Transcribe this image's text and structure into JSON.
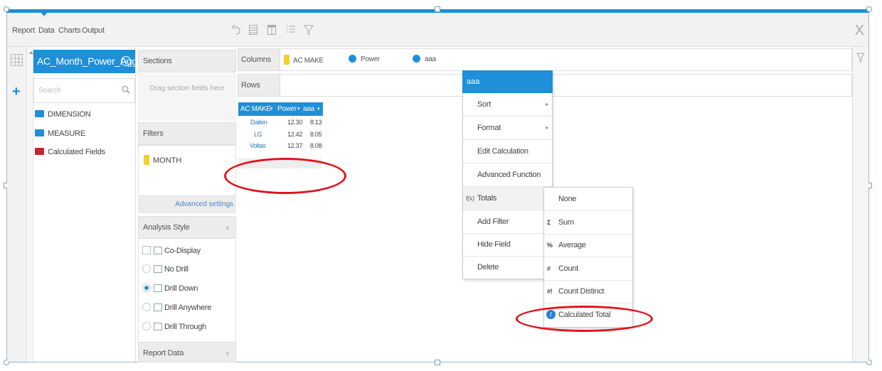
{
  "toolbar": {
    "tabs": [
      "Report",
      "Data",
      "Charts",
      "Output"
    ],
    "active_tab": "Data",
    "icons": [
      "undo-icon",
      "table-icon",
      "table-alt-icon",
      "list-icon",
      "filter-icon"
    ],
    "close_glyph": "X"
  },
  "datasource": {
    "title": "AC_Month_Power_Agg",
    "info_glyph": "i",
    "search_placeholder": "Search",
    "tree": [
      {
        "label": "DIMENSION",
        "color": "#1e8fd8"
      },
      {
        "label": "MEASURE",
        "color": "#1e8fd8"
      },
      {
        "label": "Calculated Fields",
        "color": "#c0282d"
      }
    ]
  },
  "sections": {
    "header": "Sections",
    "drop_hint": "Drag section fields here"
  },
  "filters": {
    "header": "Filters",
    "items": [
      "MONTH"
    ],
    "advanced_settings": "Advanced settings"
  },
  "analysis_style": {
    "header": "Analysis Style",
    "options": [
      {
        "label": "Co-Display",
        "kind": "checkbox",
        "checked": false
      },
      {
        "label": "No Drill",
        "kind": "radio",
        "checked": false
      },
      {
        "label": "Drill Down",
        "kind": "radio",
        "checked": true
      },
      {
        "label": "Drill Anywhere",
        "kind": "radio",
        "checked": false
      },
      {
        "label": "Drill Through",
        "kind": "radio",
        "checked": false
      }
    ]
  },
  "report_data": {
    "header": "Report Data"
  },
  "columns_bar": {
    "label": "Columns",
    "fields": [
      {
        "label": "AC MAKE",
        "kind": "dimension"
      },
      {
        "label": "Power",
        "kind": "measure"
      },
      {
        "label": "aaa",
        "kind": "measure"
      }
    ]
  },
  "rows_bar": {
    "label": "Rows"
  },
  "report_table": {
    "headers": [
      "AC MAKE",
      "Power",
      "aaa"
    ],
    "rows": [
      [
        "Daikin",
        "12.30",
        "8.13"
      ],
      [
        "LG",
        "12.42",
        "8.05"
      ],
      [
        "Voltas",
        "12.37",
        "8.08"
      ]
    ]
  },
  "context_menu": {
    "title": "aaa",
    "items": [
      {
        "label": "Sort",
        "submenu": true
      },
      {
        "label": "Format",
        "submenu": true
      },
      {
        "label": "Edit Calculation",
        "submenu": false
      },
      {
        "label": "Advanced Function",
        "submenu": false
      },
      {
        "label": "Totals",
        "submenu": false,
        "icon": "fx-icon",
        "active": true
      },
      {
        "label": "Add Filter",
        "submenu": false
      },
      {
        "label": "Hide Field",
        "submenu": false
      },
      {
        "label": "Delete",
        "submenu": false
      }
    ],
    "fx_glyph": "f(x)"
  },
  "totals_submenu": {
    "items": [
      {
        "label": "None",
        "symbol": ""
      },
      {
        "label": "Sum",
        "symbol": "Σ"
      },
      {
        "label": "Average",
        "symbol": "%"
      },
      {
        "label": "Count",
        "symbol": "#"
      },
      {
        "label": "Count Distinct",
        "symbol": "#!"
      },
      {
        "label": "Calculated Total",
        "symbol": "calc-icon"
      }
    ]
  },
  "colors": {
    "accent": "#1e8fd8",
    "annotation": "#e0141e",
    "dimension_chip": "#f4d12a"
  }
}
